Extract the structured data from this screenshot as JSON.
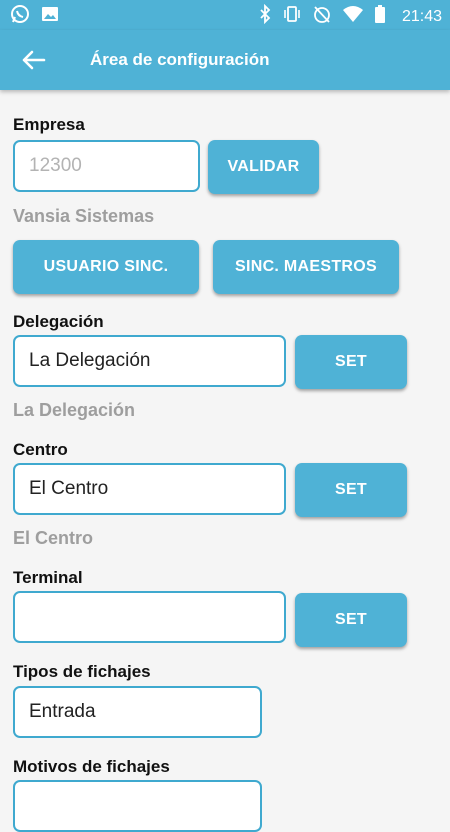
{
  "status": {
    "time": "21:43",
    "left_icons": [
      "whatsapp-icon",
      "image-icon"
    ],
    "right_icons": [
      "bluetooth-icon",
      "vibrate-icon",
      "no-alarm-icon",
      "wifi-icon",
      "battery-icon"
    ]
  },
  "appbar": {
    "title": "Área de configuración",
    "back_icon": "arrow-left-icon"
  },
  "empresa": {
    "label": "Empresa",
    "placeholder": "12300",
    "value": "",
    "validate_label": "VALIDAR",
    "company_name": "Vansia Sistemas",
    "sync_user_label": "USUARIO SINC.",
    "sync_master_label": "SINC. MAESTROS"
  },
  "delegacion": {
    "label": "Delegación",
    "value": "La Delegación",
    "set_label": "SET",
    "current": "La Delegación"
  },
  "centro": {
    "label": "Centro",
    "value": "El Centro",
    "set_label": "SET",
    "current": "El Centro"
  },
  "terminal": {
    "label": "Terminal",
    "value": "",
    "set_label": "SET"
  },
  "tipos": {
    "label": "Tipos de fichajes",
    "value": "Entrada"
  },
  "motivos": {
    "label": "Motivos de fichajes",
    "value": ""
  },
  "colors": {
    "accent": "#4fb2d6",
    "field_border": "#3fa9cf",
    "muted_text": "#9e9e9e",
    "background": "#f5f5f5"
  }
}
